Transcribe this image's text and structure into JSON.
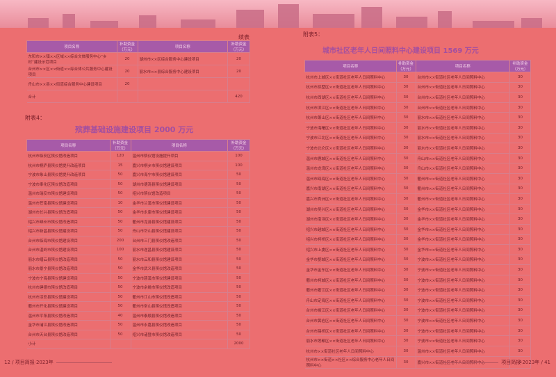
{
  "left_page": {
    "continued_label": "续表",
    "table1": {
      "headers": [
        "项目名称",
        "补助资金（万元）",
        "项目名称",
        "补助资金（万元）"
      ],
      "rows": [
        [
          "东阳市××镇××区域××综合文体服务中心“乡村”建设示范项目",
          "20",
          "湖州市××区综合服务中心建设项目",
          "20"
        ],
        [
          "台州市××区××街道××综合体公共服务中心建设项目",
          "20",
          "丽水市××县综合服务中心建设项目",
          "20"
        ],
        [
          "舟山市××县××街道综合服务中心建设项目",
          "20",
          "",
          ""
        ],
        [
          "合计",
          "",
          "",
          "420"
        ]
      ]
    },
    "section_label": "附表4：",
    "section_title": "殡葬基础设施建设项目 2000 万元",
    "table2": {
      "headers": [
        "项目名称",
        "补助资金（万元）",
        "项目名称",
        "补助资金（万元）"
      ],
      "rows": [
        [
          "杭州市临安区殡仪馆改造项目",
          "120",
          "温州市殡仪馆设施提升项目",
          "100"
        ],
        [
          "杭州市桐庐县殡仪馆提升改造项目",
          "15",
          "嘉兴市桐乡市殡仪馆建设项目",
          "100"
        ],
        [
          "宁波市象山县殡仪馆提升改造项目",
          "50",
          "嘉兴市海宁市殡仪馆建设项目",
          "50"
        ],
        [
          "宁波市奉化区殡仪馆改造项目",
          "50",
          "湖州市德清县殡仪馆建设项目",
          "50"
        ],
        [
          "温州市瑞安市殡仪馆建设项目",
          "50",
          "绍兴市殡仪馆改造项目",
          "50"
        ],
        [
          "温州市苍南县殡仪馆建设项目",
          "10",
          "金华市兰溪市殡仪馆建设项目",
          "50"
        ],
        [
          "湖州市长兴县殡仪馆改造项目",
          "50",
          "金华市永康市殡仪馆建设项目",
          "50"
        ],
        [
          "绍兴市嵊州市殡仪馆改造项目",
          "50",
          "衢州市龙游县殡仪馆建设项目",
          "50"
        ],
        [
          "绍兴市新昌县殡仪馆建设项目",
          "50",
          "舟山市岱山县殡仪馆建设项目",
          "50"
        ],
        [
          "台州市临海市殡仪馆建设项目",
          "200",
          "台州市三门县殡仪馆改造项目",
          "50"
        ],
        [
          "台州市温岭市殡仪馆建设项目",
          "100",
          "丽水市遂昌县殡仪馆建设项目",
          "50"
        ],
        [
          "丽水市缙云县殡仪馆改造项目",
          "50",
          "丽水市云和县殡仪馆建设项目",
          "50"
        ],
        [
          "丽水市景宁县殡仪馆改造项目",
          "50",
          "金华市武义县殡仪馆改造项目",
          "50"
        ],
        [
          "宁波市宁海县殡仪馆建设项目",
          "50",
          "宁波市慈溪市殡仪馆建设项目",
          "50"
        ],
        [
          "杭州市建德市殡仪馆改造项目",
          "50",
          "宁波市余姚市殡仪馆改造项目",
          "50"
        ],
        [
          "杭州市淳安县殡仪馆建设项目",
          "50",
          "衢州市江山市殡仪馆改造项目",
          "50"
        ],
        [
          "衢州市开化县殡仪馆建设项目",
          "50",
          "衢州市常山县殡仪馆改造项目",
          "50"
        ],
        [
          "温州市平阳县殡仪馆改造项目",
          "40",
          "温州市泰顺县殡仪馆改造项目",
          "50"
        ],
        [
          "金华市浦江县殡仪馆改造项目",
          "50",
          "温州市永嘉县殡仪馆改造项目",
          "50"
        ],
        [
          "台州市天台县殡仪馆改造项目",
          "50",
          "绍兴市诸暨市殡仪馆改造项目",
          "50"
        ],
        [
          "小计",
          "",
          "",
          "2000"
        ]
      ]
    },
    "footer_text": "12 / 项目简报·2023年"
  },
  "right_page": {
    "section_label": "附表5：",
    "section_title": "城市社区老年人日间照料中心建设项目 1569 万元",
    "table": {
      "headers": [
        "项目名称",
        "补助资金（万元）",
        "项目名称",
        "补助资金（万元）"
      ],
      "rows": [
        [
          "杭州市上城区××街道社区老年人日间照料中心",
          "30",
          "台州市××街道社区老年人日间照料中心",
          "30"
        ],
        [
          "杭州市拱墅区××街道社区老年人日间照料中心",
          "30",
          "台州市××街道社区老年人日间照料中心",
          "30"
        ],
        [
          "杭州市西湖区××街道社区老年人日间照料中心",
          "30",
          "台州市××街道社区老年人日间照料中心",
          "30"
        ],
        [
          "杭州市滨江区××街道社区老年人日间照料中心",
          "30",
          "台州市××街道社区老年人日间照料中心",
          "30"
        ],
        [
          "杭州市萧山区××街道社区老年人日间照料中心",
          "30",
          "丽水市××街道社区老年人日间照料中心",
          "30"
        ],
        [
          "宁波市海曙区××街道社区老年人日间照料中心",
          "30",
          "丽水市××街道社区老年人日间照料中心",
          "30"
        ],
        [
          "宁波市江北区××街道社区老年人日间照料中心",
          "30",
          "丽水市××街道社区老年人日间照料中心",
          "30"
        ],
        [
          "宁波市北仑区××街道社区老年人日间照料中心",
          "30",
          "丽水市××街道社区老年人日间照料中心",
          "30"
        ],
        [
          "温州市鹿城区××街道社区老年人日间照料中心",
          "30",
          "舟山市××街道社区老年人日间照料中心",
          "30"
        ],
        [
          "温州市龙湾区××街道社区老年人日间照料中心",
          "30",
          "舟山市××街道社区老年人日间照料中心",
          "30"
        ],
        [
          "温州市瓯海区××街道社区老年人日间照料中心",
          "30",
          "衢州市××街道社区老年人日间照料中心",
          "30"
        ],
        [
          "嘉兴市南湖区××街道社区老年人日间照料中心",
          "30",
          "衢州市××街道社区老年人日间照料中心",
          "30"
        ],
        [
          "嘉兴市秀洲区××街道社区老年人日间照料中心",
          "30",
          "衢州市××街道社区老年人日间照料中心",
          "30"
        ],
        [
          "湖州市吴兴区××街道社区老年人日间照料中心",
          "30",
          "金华市××街道社区老年人日间照料中心",
          "30"
        ],
        [
          "湖州市南浔区××街道社区老年人日间照料中心",
          "30",
          "金华市××街道社区老年人日间照料中心",
          "30"
        ],
        [
          "绍兴市越城区××街道社区老年人日间照料中心",
          "30",
          "金华市××街道社区老年人日间照料中心",
          "30"
        ],
        [
          "绍兴市柯桥区××街道社区老年人日间照料中心",
          "30",
          "金华市××街道社区老年人日间照料中心",
          "30"
        ],
        [
          "绍兴市上虞区××街道社区老年人日间照料中心",
          "30",
          "金华市××街道社区老年人日间照料中心",
          "30"
        ],
        [
          "金华市婺城区××街道社区老年人日间照料中心",
          "30",
          "宁波市××街道社区老年人日间照料中心",
          "30"
        ],
        [
          "金华市金东区××街道社区老年人日间照料中心",
          "30",
          "宁波市××街道社区老年人日间照料中心",
          "30"
        ],
        [
          "衢州市柯城区××街道社区老年人日间照料中心",
          "30",
          "宁波市××街道社区老年人日间照料中心",
          "30"
        ],
        [
          "衢州市衢江区××街道社区老年人日间照料中心",
          "30",
          "宁波市××街道社区老年人日间照料中心",
          "30"
        ],
        [
          "舟山市定海区××街道社区老年人日间照料中心",
          "30",
          "宁波市××街道社区老年人日间照料中心",
          "30"
        ],
        [
          "台州市椒江区××街道社区老年人日间照料中心",
          "30",
          "宁波市××街道社区老年人日间照料中心",
          "30"
        ],
        [
          "台州市黄岩区××街道社区老年人日间照料中心",
          "30",
          "宁波市××街道社区老年人日间照料中心",
          "30"
        ],
        [
          "台州市路桥区××街道社区老年人日间照料中心",
          "30",
          "宁波市××街道社区老年人日间照料中心",
          "30"
        ],
        [
          "丽水市莲都区××街道社区老年人日间照料中心",
          "30",
          "宁波市××街道社区老年人日间照料中心",
          "30"
        ],
        [
          "杭州市××街道社区老年人日间照料中心",
          "30",
          "温州市××街道社区老年人日间照料中心",
          "30"
        ],
        [
          "杭州市××街道××社区××综合服务中心老年人日间照料中心",
          "30",
          "嘉兴市××街道社区老年人日间照料中心",
          "9"
        ]
      ]
    },
    "footer_text": "项目简报·2023年 / 41"
  }
}
